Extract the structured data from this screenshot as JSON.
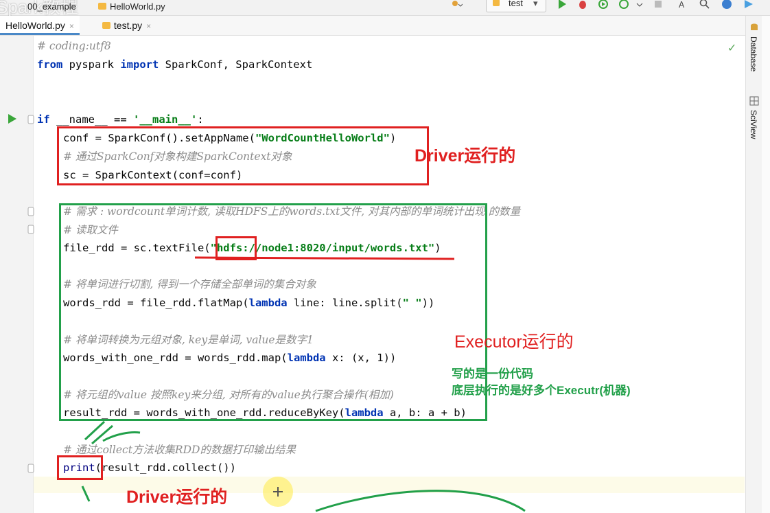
{
  "toolbar": {
    "watermark": "Spark教程",
    "breadcrumb_project": "00_example",
    "breadcrumb_file": "HelloWorld.py",
    "run_config": "test"
  },
  "tabs": [
    {
      "label": "HelloWorld.py",
      "close": "×"
    },
    {
      "label": "test.py",
      "close": "×"
    }
  ],
  "side_panels": [
    {
      "label": "Database"
    },
    {
      "label": "SciView"
    }
  ],
  "code": {
    "l1": "# coding:utf8",
    "l2_kw1": "from",
    "l2_mid": " pyspark ",
    "l2_kw2": "import",
    "l2_rest": " SparkConf, SparkContext",
    "l3_kw": "if",
    "l3_a": " __name__ == ",
    "l3_str": "'__main__'",
    "l3_b": ":",
    "l4_a": "conf = SparkConf().setAppName(",
    "l4_str": "\"WordCountHelloWorld\"",
    "l4_b": ")",
    "l5": "# 通过SparkConf对象构建SparkContext对象",
    "l6": "sc = SparkContext(conf=conf)",
    "l7": "# 需求 : wordcount单词计数, 读取HDFS上的words.txt文件, 对其内部的单词统计出现 的数量",
    "l8": "# 读取文件",
    "l9_a": "file_rdd = sc.textFile(",
    "l9_str": "\"hdfs://node1:8020/input/words.txt\"",
    "l9_b": ")",
    "l10": "# 将单词进行切割, 得到一个存储全部单词的集合对象",
    "l11_a": "words_rdd = file_rdd.flatMap(",
    "l11_kw": "lambda",
    "l11_b": " line: line.split(",
    "l11_str": "\" \"",
    "l11_c": "))",
    "l12": "# 将单词转换为元组对象, key是单词, value是数字1",
    "l13_a": "words_with_one_rdd = words_rdd.map(",
    "l13_kw": "lambda",
    "l13_b": " x: (x, 1))",
    "l14": "# 将元组的value 按照key来分组, 对所有的value执行聚合操作(相加)",
    "l15_a": "result_rdd = words_with_one_rdd.reduceByKey(",
    "l15_kw": "lambda",
    "l15_b": " a, b: a + b)",
    "l16": "# 通过collect方法收集RDD的数据打印输出结果",
    "l17_fn": "print",
    "l17_b": "(result_rdd.collect())"
  },
  "annotations": {
    "driver_top": "Driver运行的",
    "executor": "Executor运行的",
    "note_line1": "写的是一份代码",
    "note_line2": "底层执行的是好多个Executr(机器)",
    "driver_bottom": "Driver运行的"
  },
  "colors": {
    "red_box": "#e02020",
    "green_box": "#22a04a",
    "executor_text": "#e02020",
    "note_text": "#22a04a"
  }
}
